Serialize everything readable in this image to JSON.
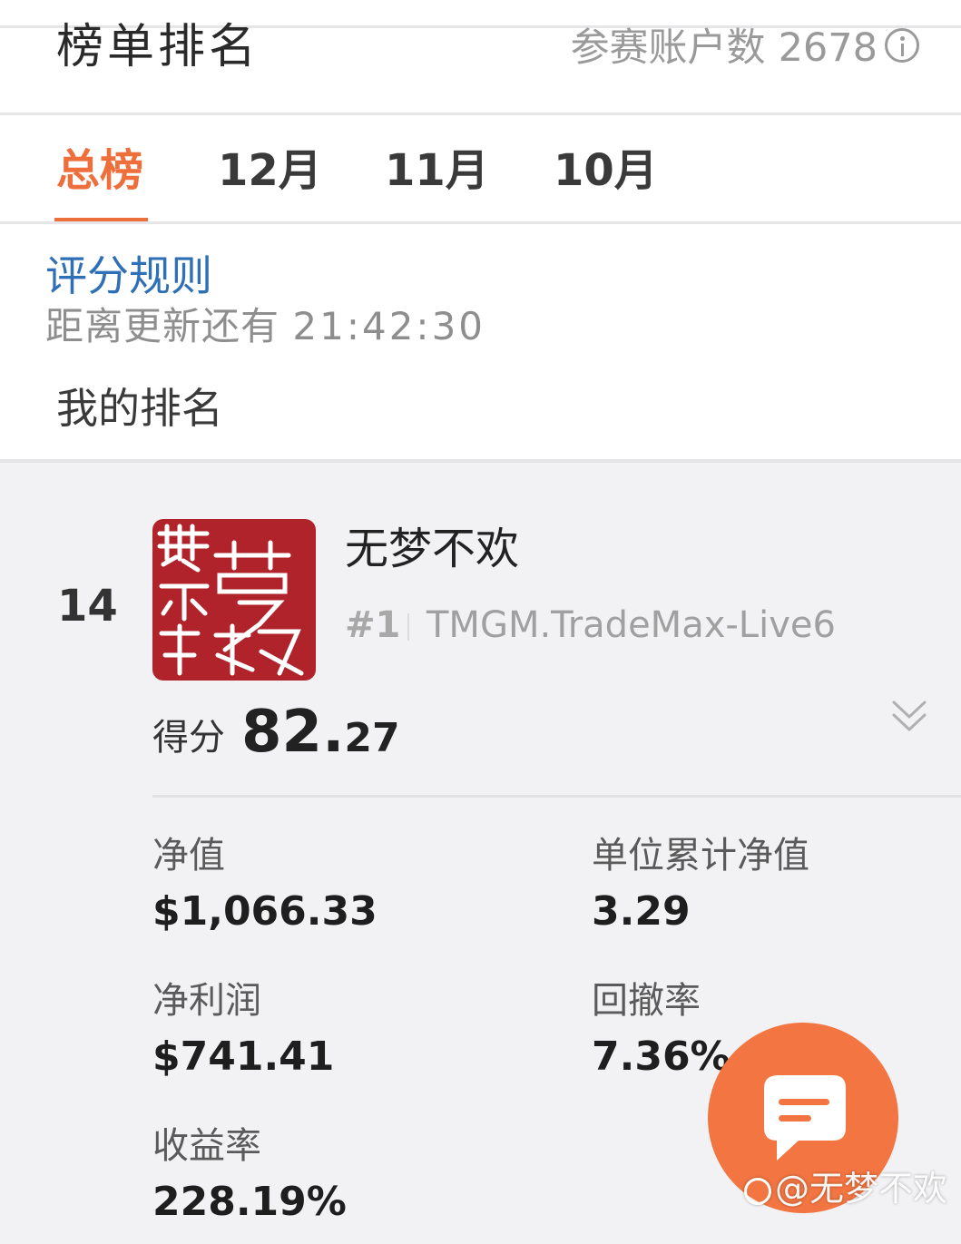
{
  "header": {
    "title": "榜单排名",
    "participants_label": "参赛账户数",
    "participants_count": "2678",
    "info_icon": "info-icon"
  },
  "tabs": [
    {
      "label": "总榜",
      "active": true
    },
    {
      "label": "12月",
      "active": false
    },
    {
      "label": "11月",
      "active": false
    },
    {
      "label": "10月",
      "active": false
    }
  ],
  "rules": {
    "link_label": "评分规则",
    "update_label": "距离更新还有",
    "countdown": "21:42:30"
  },
  "my_rank": {
    "section_label": "我的排名",
    "position": "14",
    "user_name": "无梦不欢",
    "account_rank": "#1",
    "account_name": "TMGM.TradeMax-Live6",
    "score_label": "得分",
    "score_int": "82.",
    "score_dec": "27",
    "expand_icon": "chevron-down-icon",
    "metrics": {
      "net_value": {
        "label": "净值",
        "value": "$1,066.33"
      },
      "unit_net_value": {
        "label": "单位累计净值",
        "value": "3.29"
      },
      "net_profit": {
        "label": "净利润",
        "value": "$741.41"
      },
      "drawdown": {
        "label": "回撤率",
        "value": "7.36%"
      },
      "return_rate": {
        "label": "收益率",
        "value": "228.19%"
      }
    }
  },
  "chat_button": {
    "icon": "chat-icon"
  },
  "watermark": {
    "text": "@无梦不欢"
  },
  "colors": {
    "accent": "#ee6f3c",
    "link": "#2e6fb6",
    "avatar_bg": "#b0232a",
    "fab": "#f27542"
  }
}
